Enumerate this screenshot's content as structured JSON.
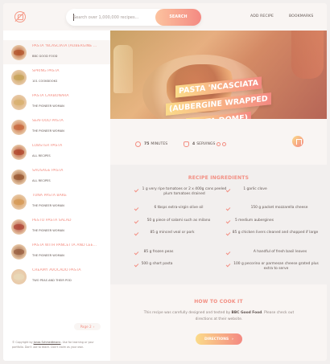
{
  "header": {
    "search_placeholder": "Search over 1,000,000 recipes...",
    "search_button": "SEARCH",
    "nav_add_recipe": "ADD RECIPE",
    "nav_bookmarks": "BOOKMARKS"
  },
  "sidebar": {
    "items": [
      {
        "title": "PASTA 'NCASCIATA (AUBERGINE ...",
        "publisher": "BBC GOOD FOOD",
        "thumb_color": "#b4582f"
      },
      {
        "title": "SPRING PASTA",
        "publisher": "101 COOKBOOKS",
        "thumb_color": "#c7a35a"
      },
      {
        "title": "PASTA CARBONARA",
        "publisher": "THE PIONEER WOMAN",
        "thumb_color": "#d8b070"
      },
      {
        "title": "SEAFOOD PASTA",
        "publisher": "THE PIONEER WOMAN",
        "thumb_color": "#c86a40"
      },
      {
        "title": "LOBSTER PASTA",
        "publisher": "ALL RECIPES",
        "thumb_color": "#b14a30"
      },
      {
        "title": "SAUSAGE PASTA",
        "publisher": "ALL RECIPES",
        "thumb_color": "#9a5a34"
      },
      {
        "title": "TUNA PASTA BAKE",
        "publisher": "THE PIONEER WOMAN",
        "thumb_color": "#d69a58"
      },
      {
        "title": "PESTO PASTA SALAD",
        "publisher": "THE PIONEER WOMAN",
        "thumb_color": "#b04a3a"
      },
      {
        "title": "PASTA WITH PANCETTA AND LEE...",
        "publisher": "THE PIONEER WOMAN",
        "thumb_color": "#9b6244"
      },
      {
        "title": "CREAMY AVOCADO PASTA",
        "publisher": "TWO PEAS AND THEIR POD",
        "thumb_color": "#e8d8b8"
      }
    ],
    "pager": "Page 2",
    "copyright_prefix": "© Copyright by",
    "copyright_link": "Jonas Schmedtmann",
    "copyright_suffix": ". Use for learning or your portfolio. Don't use to teach. Don't claim as your own."
  },
  "recipe": {
    "title_lines": [
      "PASTA 'NCASCIATA",
      "(AUBERGINE WRAPPED",
      "PASTA DOME)"
    ],
    "minutes": "75",
    "minutes_label": "MINUTES",
    "servings": "4",
    "servings_label": "SERVINGS",
    "ingredients_heading": "RECIPE INGREDIENTS",
    "ingredients": [
      "1 g very ripe tomatoes or 2 x 400g cans peeled plum tomatoes drained",
      "1 garlic clove",
      "6 tbsps extra-virgin olive oil",
      "150 g packet mozzarella cheese",
      "50 g piece of salami such as milano",
      "5 medium aubergines",
      "85 g minced veal or pork",
      "85 g chicken livers cleaned and chopped if large",
      "85 g frozen peas",
      "A handful of fresh basil leaves",
      "500 g short pasta",
      "100 g pecorino or parmesan cheese grated plus extra to serve"
    ],
    "directions_heading": "HOW TO COOK IT",
    "directions_text_1": "This recipe was carefully designed and tested by",
    "directions_publisher": "BBC Good Food",
    "directions_text_2": ". Please check out directions at their website.",
    "directions_button": "DIRECTIONS"
  },
  "colors": {
    "accent_start": "#fbdb89",
    "accent_end": "#f48982",
    "text": "#615551"
  },
  "icons": [
    "logo-icon",
    "clock-icon",
    "people-icon",
    "minus-icon",
    "plus-icon",
    "bookmark-icon",
    "arrow-right-icon",
    "check-icon"
  ]
}
